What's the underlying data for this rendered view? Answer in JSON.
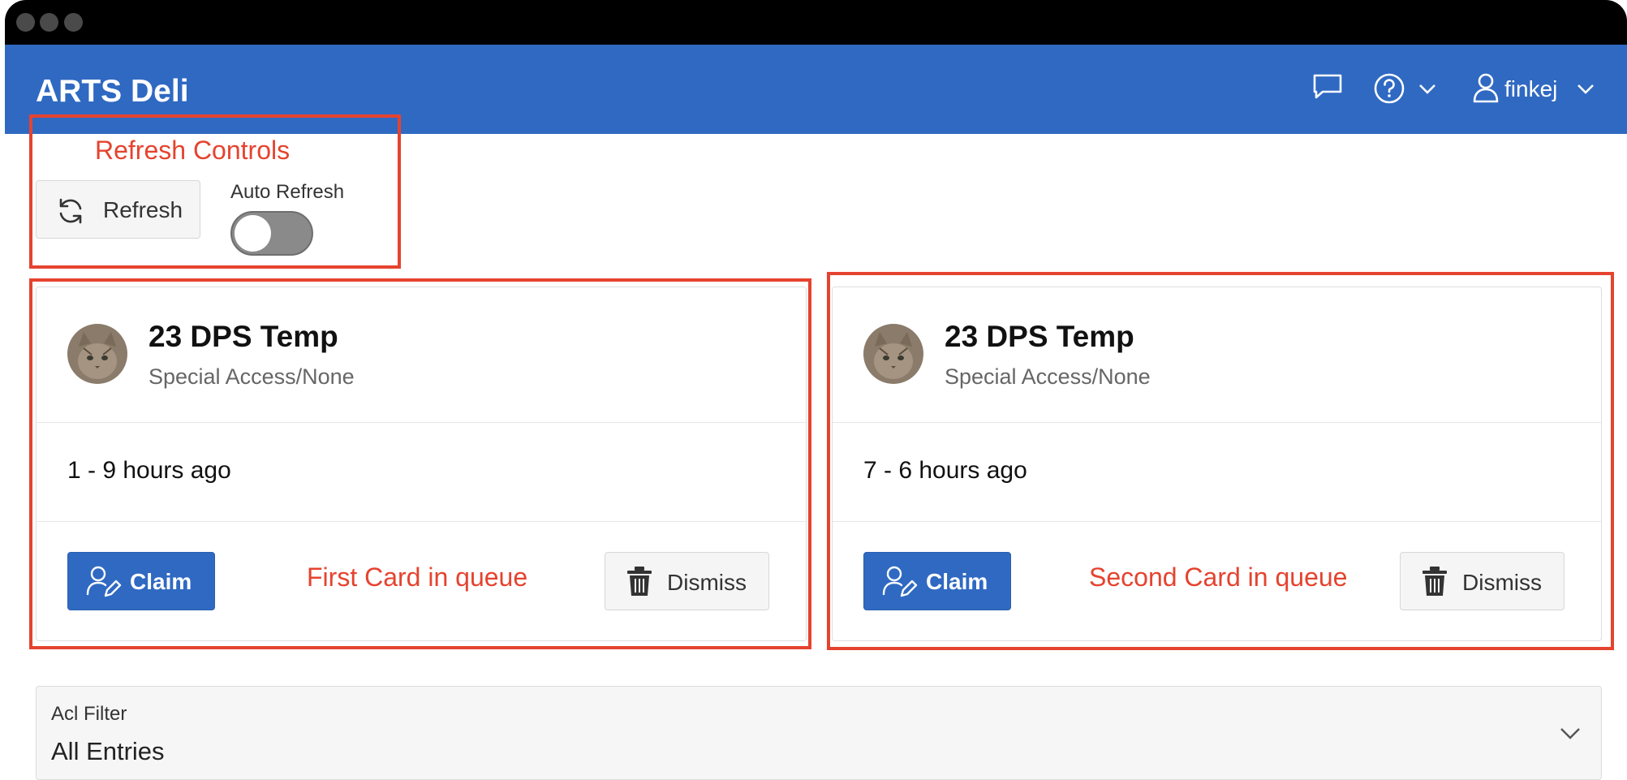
{
  "app": {
    "title": "ARTS Deli",
    "brand_color": "#2f69c2",
    "annotation_color": "#e5432f"
  },
  "header": {
    "feedback_icon": "chat-bubble-icon",
    "help_icon": "help-circle-icon",
    "user": {
      "name": "finkej",
      "icon": "user-icon"
    }
  },
  "annotations": {
    "refresh_controls": "Refresh Controls",
    "first_card": "First Card in queue",
    "second_card": "Second Card in queue"
  },
  "refresh": {
    "button_label": "Refresh",
    "auto_refresh_label": "Auto Refresh",
    "auto_refresh_on": false
  },
  "cards": [
    {
      "title": "23 DPS Temp",
      "subtitle": "Special Access/None",
      "meta": "1 - 9 hours ago",
      "claim_label": "Claim",
      "dismiss_label": "Dismiss"
    },
    {
      "title": "23 DPS Temp",
      "subtitle": "Special Access/None",
      "meta": "7 - 6 hours ago",
      "claim_label": "Claim",
      "dismiss_label": "Dismiss"
    }
  ],
  "filter": {
    "label": "Acl Filter",
    "value": "All Entries"
  }
}
